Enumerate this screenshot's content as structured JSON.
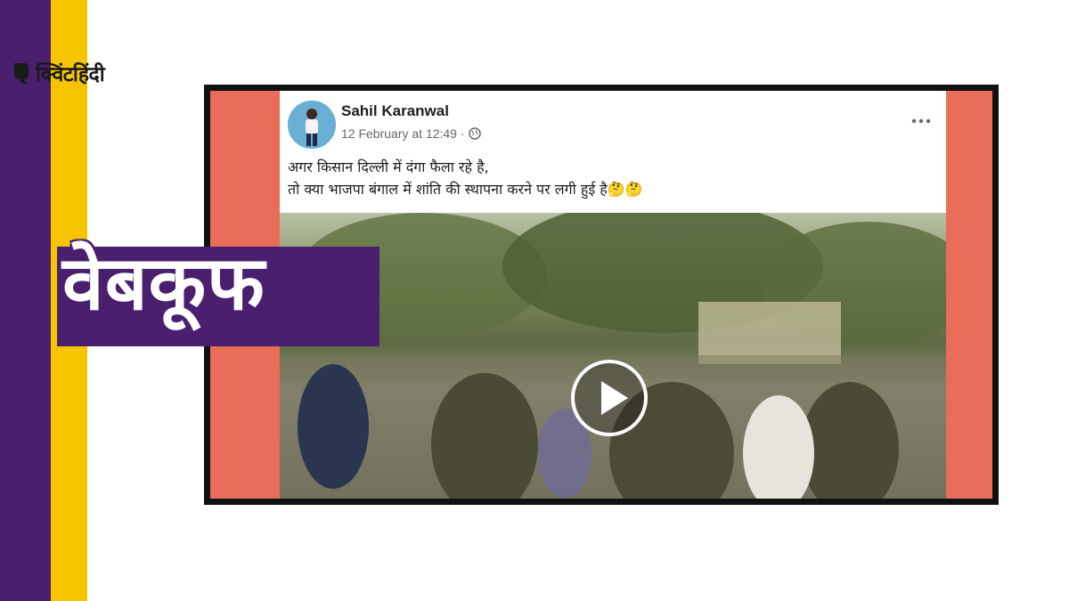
{
  "brand": {
    "name": "क्विंटहिंदी",
    "accent_colors": {
      "purple": "#4a1f6e",
      "yellow": "#f7c400",
      "frame_coral": "#e86e5a"
    }
  },
  "post": {
    "author": "Sahil Karanwal",
    "date": "12 February at 12:49 ·",
    "privacy_icon": "globe-icon",
    "menu_icon": "more-options-icon",
    "text_line1": "अगर किसान दिल्ली में दंगा फैला रहे है,",
    "text_line2": "तो क्या भाजपा बंगाल में शांति की स्थापना करने पर लगी हुई है🤔🤔"
  },
  "video": {
    "control_icon": "play-icon"
  },
  "verdict": {
    "label": "वेबकूफ"
  }
}
